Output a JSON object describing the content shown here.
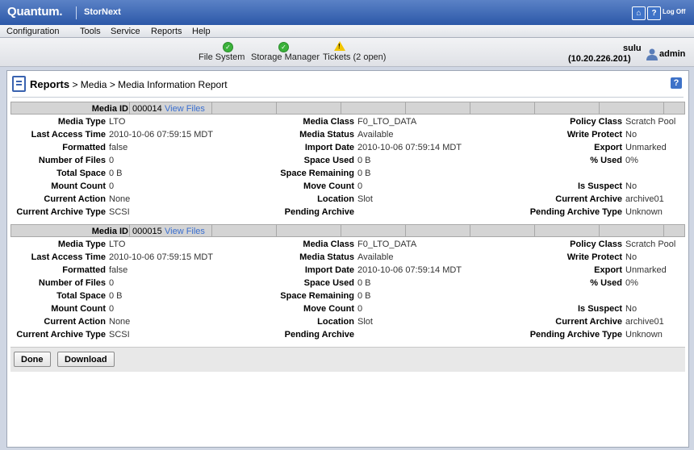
{
  "header": {
    "brand": "Quantum.",
    "product": "StorNext",
    "home_icon": "home-icon",
    "help_icon": "help-icon",
    "logoff_label": "Log Off"
  },
  "menu": [
    "Configuration",
    "Tools",
    "Service",
    "Reports",
    "Help"
  ],
  "status": {
    "file_system": "File System",
    "storage_manager": "Storage Manager",
    "tickets": "Tickets (2 open)"
  },
  "user": {
    "name": "sulu",
    "ip": "(10.20.226.201)",
    "role": "admin"
  },
  "breadcrumb": {
    "title": "Reports",
    "path": " > Media > Media Information Report"
  },
  "labels": {
    "media_id": "Media ID",
    "view_files": "View Files",
    "media_type": "Media Type",
    "last_access_time": "Last Access Time",
    "formatted": "Formatted",
    "number_of_files": "Number of Files",
    "total_space": "Total Space",
    "mount_count": "Mount Count",
    "current_action": "Current Action",
    "current_archive_type": "Current Archive Type",
    "media_class": "Media Class",
    "media_status": "Media Status",
    "import_date": "Import Date",
    "space_used": "Space Used",
    "space_remaining": "Space Remaining",
    "move_count": "Move Count",
    "location": "Location",
    "pending_archive": "Pending Archive",
    "policy_class": "Policy Class",
    "write_protect": "Write Protect",
    "export": "Export",
    "pct_used": "% Used",
    "is_suspect": "Is Suspect",
    "current_archive": "Current Archive",
    "pending_archive_type": "Pending Archive Type"
  },
  "media": [
    {
      "media_id": "000014",
      "media_type": "LTO",
      "last_access_time": "2010-10-06 07:59:15 MDT",
      "formatted": "false",
      "number_of_files": "0",
      "total_space": "0 B",
      "mount_count": "0",
      "current_action": "None",
      "current_archive_type": "SCSI",
      "media_class": "F0_LTO_DATA",
      "media_status": "Available",
      "import_date": "2010-10-06 07:59:14 MDT",
      "space_used": "0 B",
      "space_remaining": "0 B",
      "move_count": "0",
      "location": "Slot",
      "pending_archive": "",
      "policy_class": "Scratch Pool",
      "write_protect": "No",
      "export": "Unmarked",
      "pct_used": "0%",
      "is_suspect": "No",
      "current_archive": "archive01",
      "pending_archive_type": "Unknown"
    },
    {
      "media_id": "000015",
      "media_type": "LTO",
      "last_access_time": "2010-10-06 07:59:15 MDT",
      "formatted": "false",
      "number_of_files": "0",
      "total_space": "0 B",
      "mount_count": "0",
      "current_action": "None",
      "current_archive_type": "SCSI",
      "media_class": "F0_LTO_DATA",
      "media_status": "Available",
      "import_date": "2010-10-06 07:59:14 MDT",
      "space_used": "0 B",
      "space_remaining": "0 B",
      "move_count": "0",
      "location": "Slot",
      "pending_archive": "",
      "policy_class": "Scratch Pool",
      "write_protect": "No",
      "export": "Unmarked",
      "pct_used": "0%",
      "is_suspect": "No",
      "current_archive": "archive01",
      "pending_archive_type": "Unknown"
    }
  ],
  "buttons": {
    "done": "Done",
    "download": "Download"
  },
  "colors": {
    "topbar": "#2c58a8",
    "link": "#3a6fd0",
    "ok_status": "#3bb23b",
    "warn_status": "#f2c500"
  }
}
